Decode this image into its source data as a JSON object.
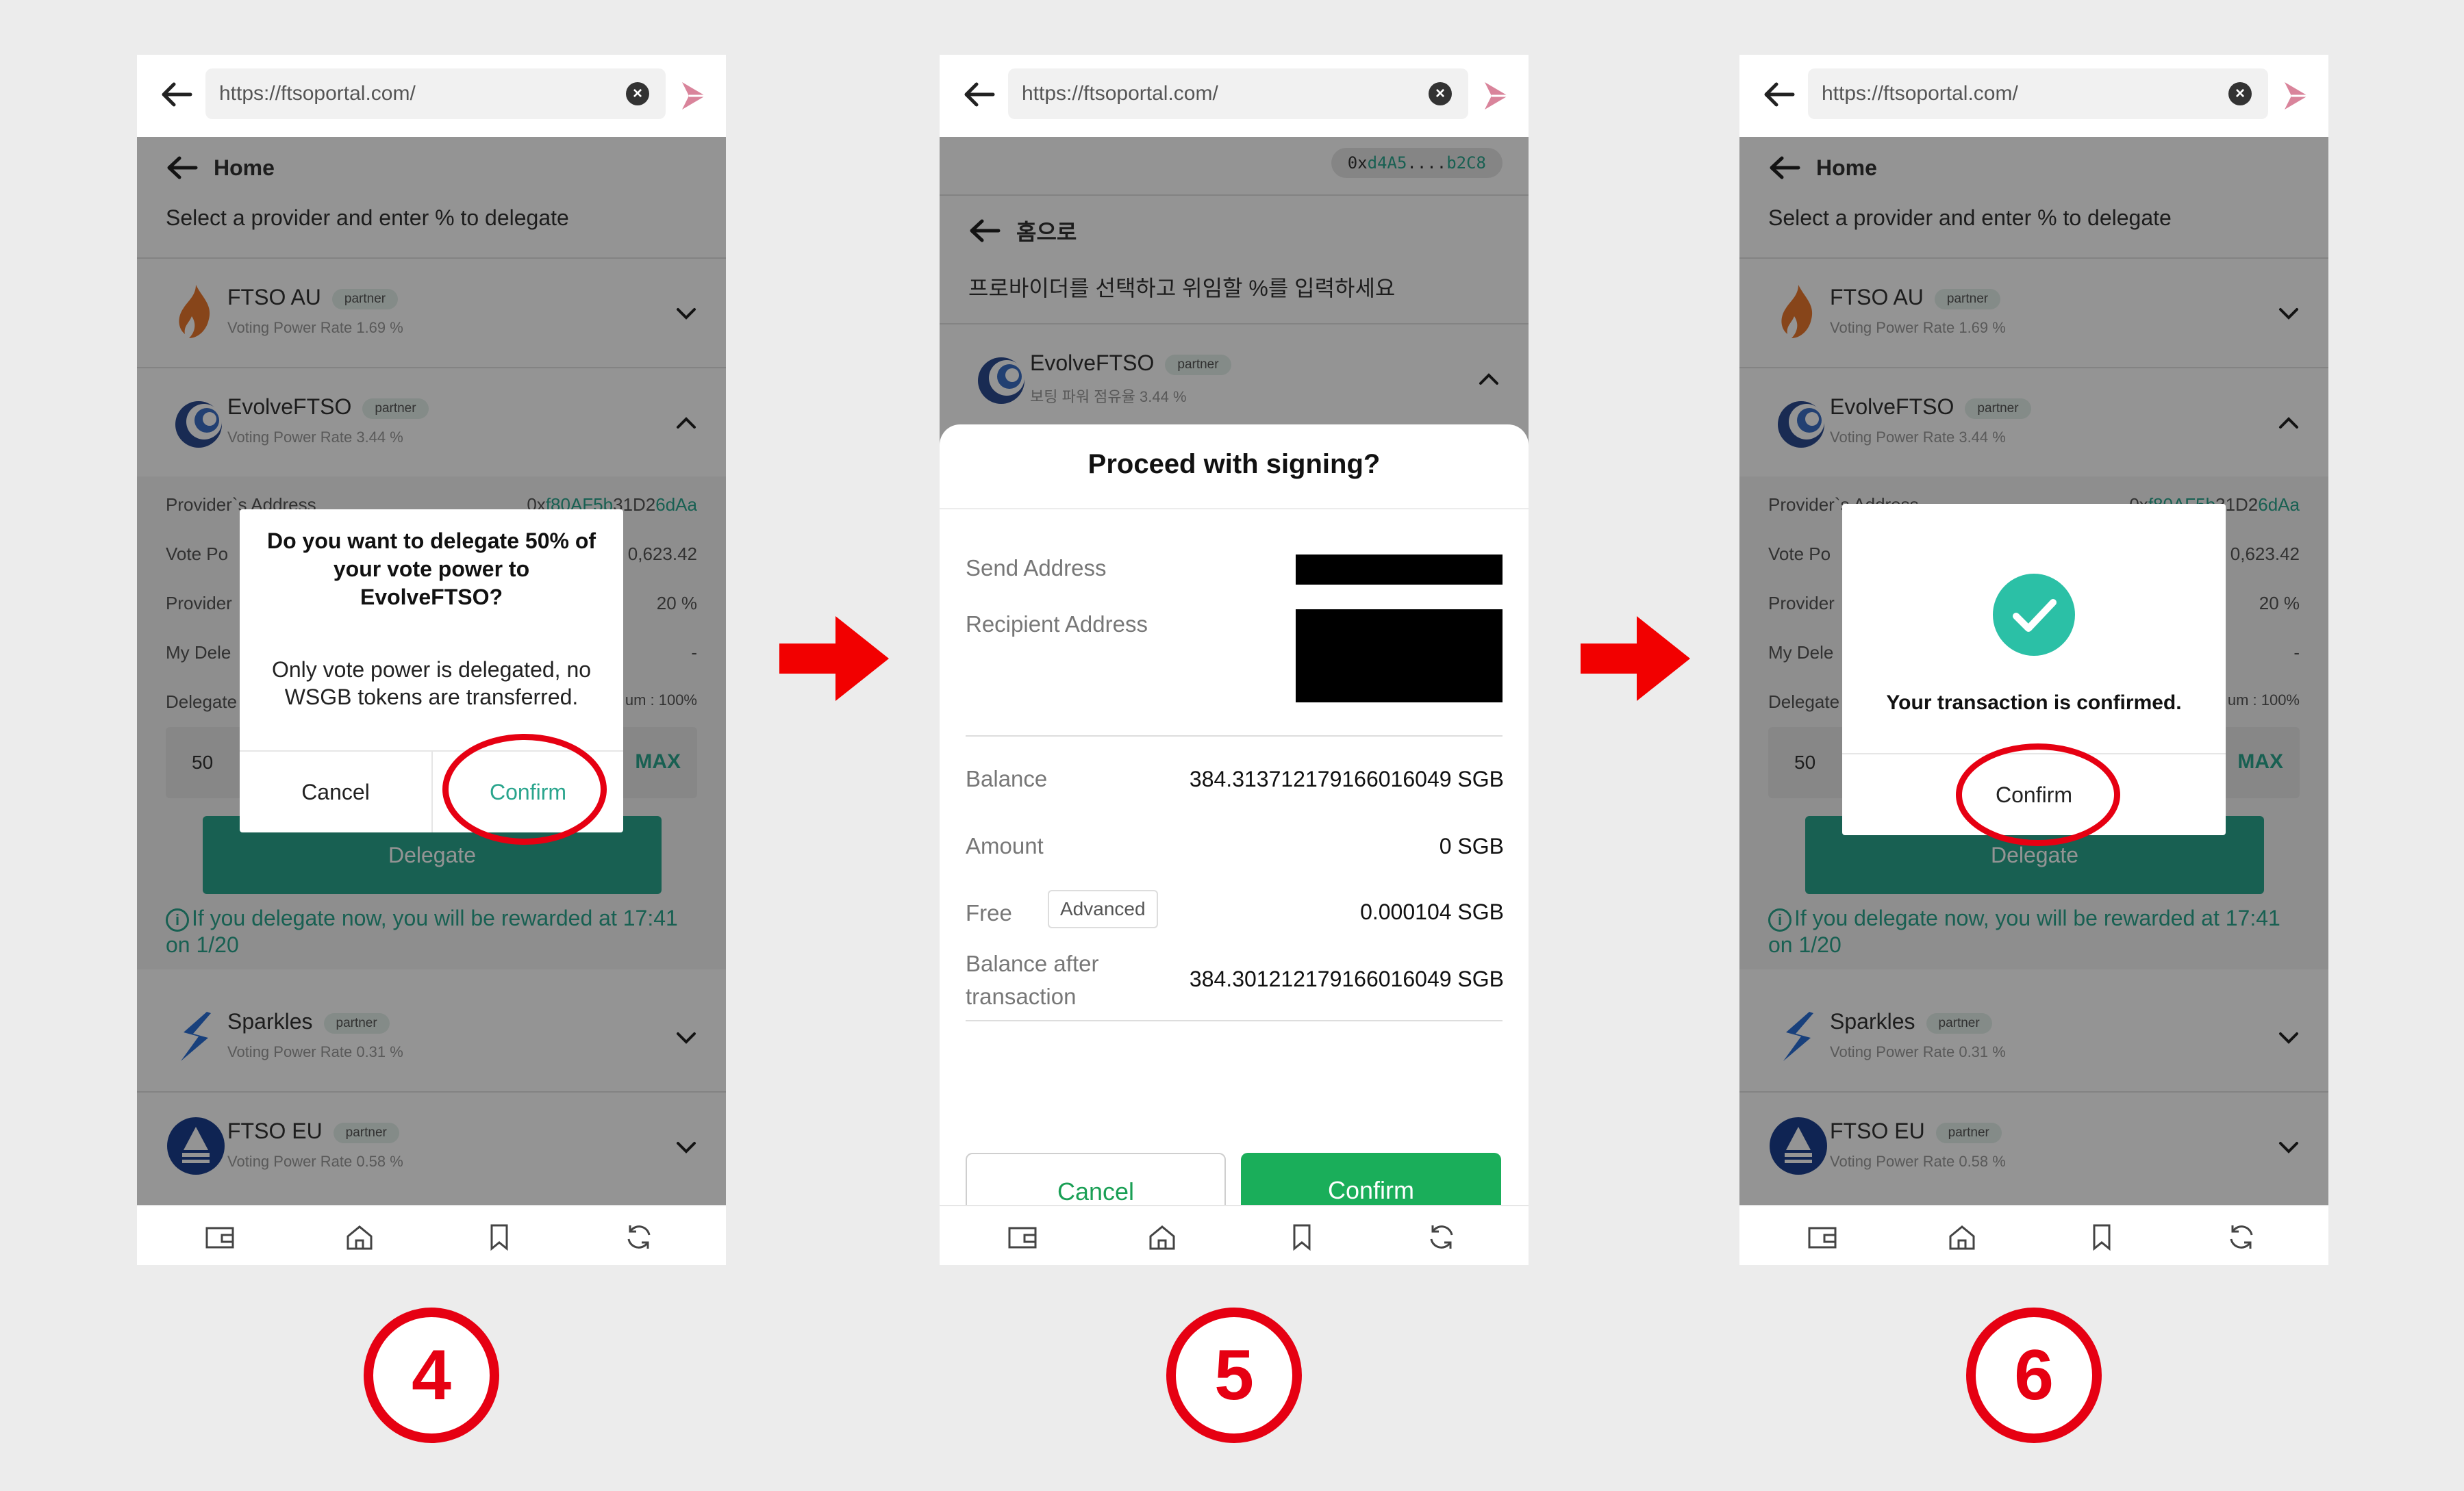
{
  "url": "https://ftsoportal.com/",
  "nav": {
    "home": "Home",
    "subtitle": "Select a provider and enter % to delegate"
  },
  "nav_ko": {
    "home": "홈으로",
    "subtitle": "프로바이더를 선택하고 위임할 %를 입력하세요"
  },
  "wallet_address": {
    "prefix": "0x",
    "mid": "d4A5",
    "dots": "....",
    "suffix": "b2C8"
  },
  "providers": [
    {
      "name": "FTSO AU",
      "badge": "partner",
      "rate": "Voting Power Rate 1.69 %"
    },
    {
      "name": "EvolveFTSO",
      "badge": "partner",
      "rate": "Voting Power Rate 3.44 %"
    },
    {
      "name": "Sparkles",
      "badge": "partner",
      "rate": "Voting Power Rate 0.31 %"
    },
    {
      "name": "FTSO EU",
      "badge": "partner",
      "rate": "Voting Power Rate 0.58 %"
    }
  ],
  "evolve_ko": {
    "name": "EvolveFTSO",
    "badge": "partner",
    "rate": "보팅 파워 점유율 3.44 %"
  },
  "details": {
    "provider_address_label": "Provider`s Address",
    "provider_address_prefix": "0x",
    "provider_address_mid": "f80AF5b",
    "provider_address_end": "31D2",
    "provider_address_suffix": "6dAa",
    "vote_power_label": "Vote Po",
    "vote_power_value": "0,623.42",
    "provider_fee_label": "Provider",
    "provider_fee_value": "20 %",
    "my_delegation_label": "My Dele",
    "my_delegation_value": "-",
    "delegate_label": "Delegate",
    "delegate_max_note": "um : 100%",
    "amount_value": "50",
    "max_label": "MAX",
    "delegate_button": "Delegate",
    "reward_icon": "i",
    "reward_text": "If you delegate now, you will be rewarded at 17:41 on 1/20"
  },
  "dialog_delegate": {
    "title": "Do you want to delegate 50% of your vote power to EvolveFTSO?",
    "body": "Only vote power is delegated, no WSGB tokens are transferred.",
    "cancel": "Cancel",
    "confirm": "Confirm"
  },
  "signing": {
    "title": "Proceed with signing?",
    "send_address_label": "Send Address",
    "recipient_address_label": "Recipient Address",
    "balance_label": "Balance",
    "balance_value": "384.313712179166016049 SGB",
    "amount_label": "Amount",
    "amount_value": "0 SGB",
    "fee_label": "Free",
    "fee_tag": "Advanced",
    "fee_value": "0.000104 SGB",
    "balance_after_label": "Balance after transaction",
    "balance_after_value": "384.301212179166016049 SGB",
    "cancel": "Cancel",
    "confirm": "Confirm"
  },
  "confirmed": {
    "message": "Your transaction is confirmed.",
    "confirm": "Confirm"
  },
  "steps": [
    "4",
    "5",
    "6"
  ],
  "colors": {
    "teal": "#2aa58d",
    "green": "#1aae5a",
    "red": "#e60012",
    "check": "#2bc0a6"
  },
  "icons": [
    "back-arrow-icon",
    "clear-icon",
    "extension-icon",
    "wallet-icon",
    "home-icon",
    "bookmark-icon",
    "refresh-icon",
    "chevron-down-icon",
    "chevron-up-icon",
    "check-icon",
    "right-arrow-icon"
  ]
}
